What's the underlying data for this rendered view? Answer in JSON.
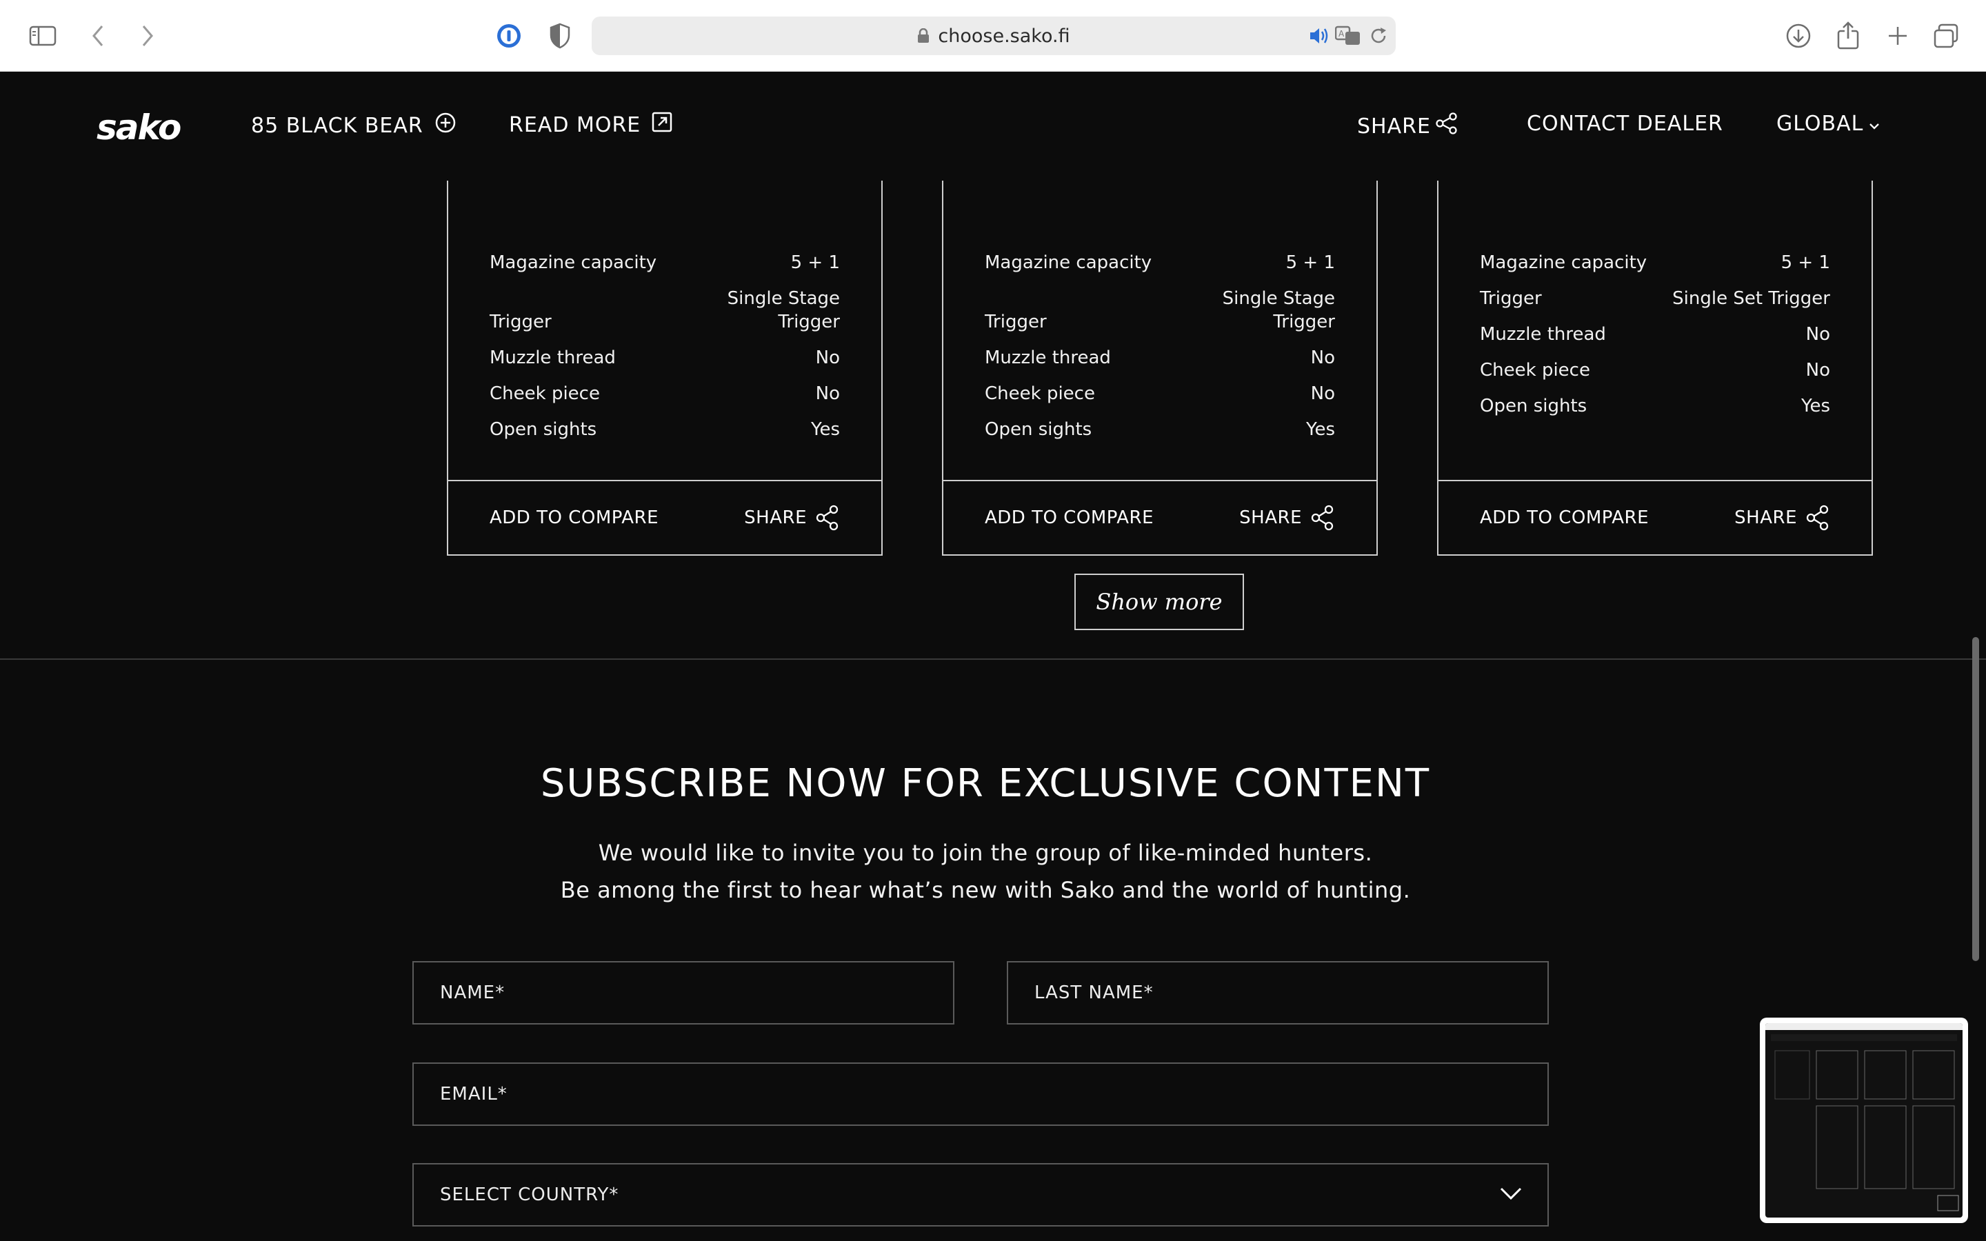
{
  "browser": {
    "url": "choose.sako.fi"
  },
  "nav": {
    "logo": "sako",
    "model": "85 BLACK BEAR",
    "read_more": "READ MORE",
    "share": "SHARE",
    "contact": "CONTACT DEALER",
    "region": "GLOBAL"
  },
  "cards": [
    {
      "specs": [
        {
          "label": "Magazine capacity",
          "value": "5 + 1"
        },
        {
          "label": "Trigger",
          "value": "Single Stage Trigger"
        },
        {
          "label": "Muzzle thread",
          "value": "No"
        },
        {
          "label": "Cheek piece",
          "value": "No"
        },
        {
          "label": "Open sights",
          "value": "Yes"
        }
      ],
      "compare": "ADD TO COMPARE",
      "share": "SHARE"
    },
    {
      "specs": [
        {
          "label": "Magazine capacity",
          "value": "5 + 1"
        },
        {
          "label": "Trigger",
          "value": "Single Stage Trigger"
        },
        {
          "label": "Muzzle thread",
          "value": "No"
        },
        {
          "label": "Cheek piece",
          "value": "No"
        },
        {
          "label": "Open sights",
          "value": "Yes"
        }
      ],
      "compare": "ADD TO COMPARE",
      "share": "SHARE"
    },
    {
      "specs": [
        {
          "label": "Magazine capacity",
          "value": "5 + 1"
        },
        {
          "label": "Trigger",
          "value": "Single Set Trigger"
        },
        {
          "label": "Muzzle thread",
          "value": "No"
        },
        {
          "label": "Cheek piece",
          "value": "No"
        },
        {
          "label": "Open sights",
          "value": "Yes"
        }
      ],
      "compare": "ADD TO COMPARE",
      "share": "SHARE"
    }
  ],
  "show_more": "Show more",
  "subscribe": {
    "title": "SUBSCRIBE NOW FOR EXCLUSIVE CONTENT",
    "line1": "We would like to invite you to join the group of like-minded hunters.",
    "line2": "Be among the first to hear what’s new with Sako and the world of hunting.",
    "name_placeholder": "NAME*",
    "last_name_placeholder": "LAST NAME*",
    "email_placeholder": "EMAIL*",
    "country_placeholder": "SELECT COUNTRY*"
  }
}
